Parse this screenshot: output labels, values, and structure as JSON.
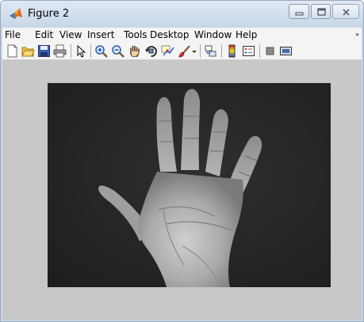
{
  "window": {
    "title": "Figure 2",
    "buttons": {
      "minimize": "minimize",
      "maximize": "maximize",
      "close": "close"
    }
  },
  "menu": {
    "items": [
      "File",
      "Edit",
      "View",
      "Insert",
      "Tools",
      "Desktop",
      "Window",
      "Help"
    ],
    "overflow_icon": "double-chevron-icon"
  },
  "toolbar": {
    "icons": [
      "new-figure-icon",
      "open-file-icon",
      "save-icon",
      "print-icon",
      "edit-plot-arrow-icon",
      "zoom-in-icon",
      "zoom-out-icon",
      "pan-hand-icon",
      "rotate-3d-icon",
      "data-cursor-icon",
      "brush-icon",
      "link-plot-icon",
      "colorbar-icon",
      "legend-icon",
      "hide-plot-tools-icon",
      "show-plot-tools-icon"
    ]
  },
  "figure": {
    "image_alt": "grayscale photo of an open hand palm on dark background"
  },
  "colors": {
    "titlebar": "#c7d6e8",
    "menubar": "#f4f4f4",
    "figure_background": "#c8c8c8",
    "image_background": "#262626"
  }
}
